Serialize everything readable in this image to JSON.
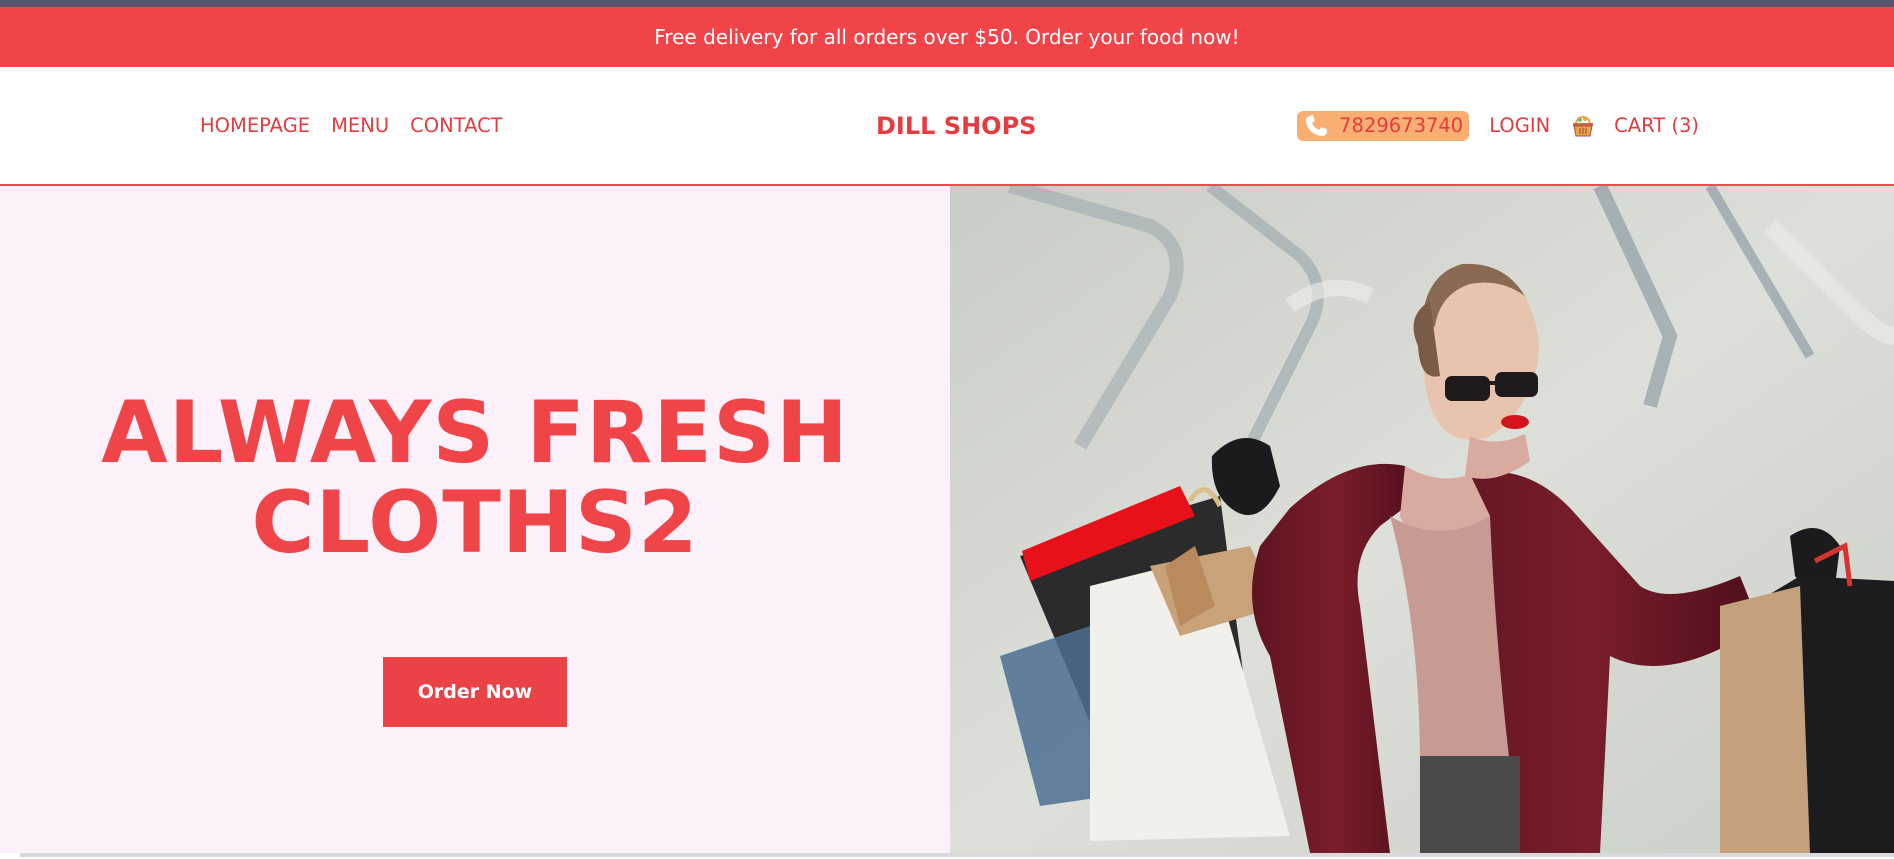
{
  "promo": {
    "text": "Free delivery for all orders over $50. Order your food now!"
  },
  "nav": {
    "left_items": [
      {
        "label": "HOMEPAGE"
      },
      {
        "label": "MENU"
      },
      {
        "label": "CONTACT"
      }
    ],
    "brand": "DILL SHOPS",
    "phone": {
      "icon": "phone-icon",
      "number": "7829673740"
    },
    "login_label": "LOGIN",
    "cart": {
      "icon": "basket-icon",
      "label": "CART (3)"
    }
  },
  "hero": {
    "title_line1": "ALWAYS FRESH",
    "title_line2": "CLOTHS2",
    "button_label": "Order Now"
  },
  "colors": {
    "accent": "#ef4448",
    "promo_bg": "#f04448",
    "top_strip": "#56546b",
    "phone_badge_bg": "#f9ae72",
    "hero_left_bg": "#fcf0fb"
  }
}
